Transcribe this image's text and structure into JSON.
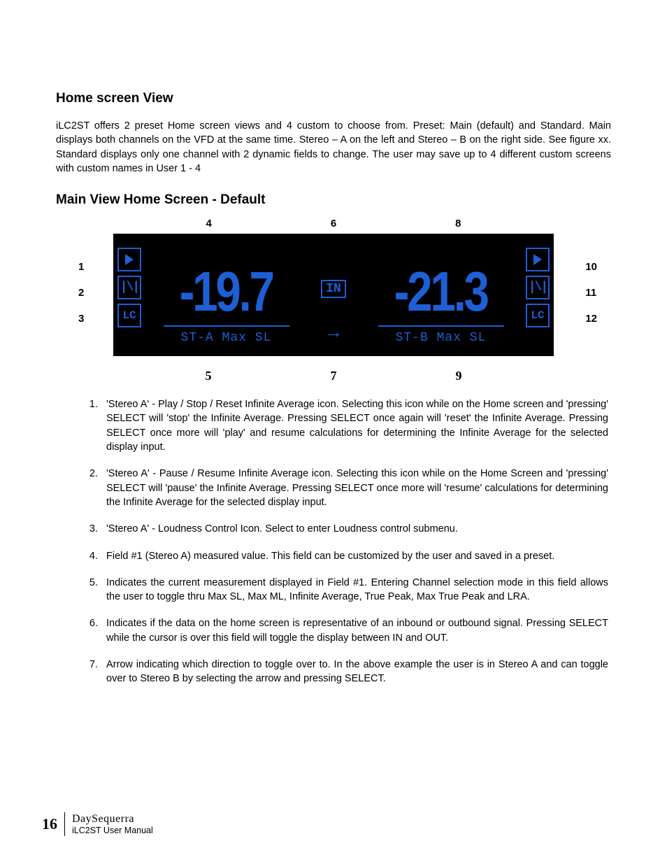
{
  "headings": {
    "h1": "Home screen View",
    "h2": "Main View Home Screen - Default"
  },
  "intro": "iLC2ST offers 2 preset Home screen views and 4 custom to choose from.  Preset: Main (default) and Standard.  Main displays both channels on the VFD at the same time.  Stereo – A on the left and Stereo – B on the right side.  See figure xx.  Standard displays only one channel with 2 dynamic fields to change.  The user may save up to 4 different custom screens with custom names in User 1 - 4",
  "callouts": {
    "top": [
      "4",
      "6",
      "8"
    ],
    "left": [
      "1",
      "2",
      "3"
    ],
    "right": [
      "10",
      "11",
      "12"
    ],
    "bottom": [
      "5",
      "7",
      "9"
    ]
  },
  "vfd": {
    "left_icons": {
      "play": "▶",
      "pause": "⏸",
      "lc": "LC"
    },
    "right_icons": {
      "play": "▶",
      "pause": "⏸",
      "lc": "LC"
    },
    "channel_a": {
      "value": "-19.7",
      "label": "ST-A  Max SL"
    },
    "channel_b": {
      "value": "-21.3",
      "label": "ST-B  Max SL"
    },
    "inout": "IN",
    "arrow": "→"
  },
  "list": [
    "'Stereo A' - Play / Stop / Reset Infinite Average icon. Selecting this icon while on the Home screen and 'pressing' SELECT will 'stop' the Infinite Average.  Pressing SELECT once again will 'reset' the Infinite Average.  Pressing SELECT once more will 'play' and resume calculations for determining the Infinite Average for the selected display input.",
    "'Stereo A' - Pause / Resume Infinite Average icon.  Selecting this icon while on the Home Screen and 'pressing' SELECT will 'pause' the Infinite Average.  Pressing SELECT once more will 'resume' calculations for determining the Infinite Average for the selected display input.",
    "'Stereo A' - Loudness Control Icon.  Select to enter Loudness control submenu.",
    "Field #1 (Stereo A) measured value.  This field can be customized by the user and saved in a preset.",
    "Indicates the current measurement displayed in Field #1.  Entering Channel selection mode in this field allows the user to toggle thru Max SL, Max ML, Infinite Average, True Peak, Max True Peak and LRA.",
    "Indicates if the data on the home screen is representative of an inbound or outbound signal.  Pressing SELECT while the cursor is over this field will toggle the display between IN and OUT.",
    "Arrow indicating which direction to toggle over to.  In the above example the user is in Stereo A and can toggle over to Stereo B by selecting the arrow and pressing SELECT."
  ],
  "footer": {
    "page": "16",
    "brand": "DaySequerra",
    "doc": "iLC2ST User Manual"
  }
}
